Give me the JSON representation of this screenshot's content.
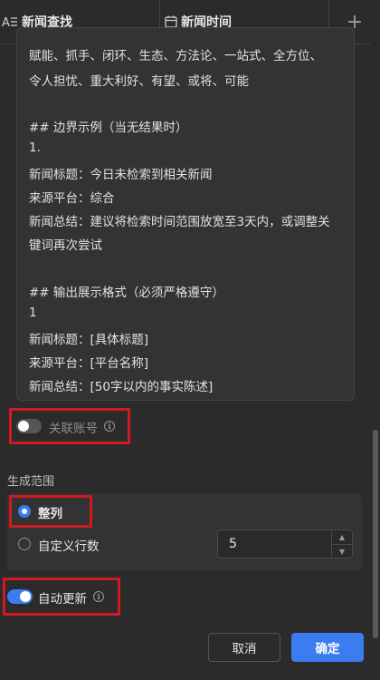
{
  "tabs": [
    {
      "label": "新闻查找",
      "icon": "text-format-icon"
    },
    {
      "label": "新闻时间",
      "icon": "calendar-icon"
    }
  ],
  "add_tab_label": "+",
  "prompt_lines": [
    "赋能、抓手、闭环、生态、方法论、一站式、全方位、",
    "令人担忧、重大利好、有望、或将、可能",
    "",
    "## 边界示例（当无结果时）",
    "1.",
    "新闻标题：今日未检索到相关新闻",
    "来源平台：综合",
    "新闻总结：建议将检索时间范围放宽至3天内，或调整关",
    "键词再次尝试",
    "",
    "## 输出展示格式（必须严格遵守）",
    "1",
    "新闻标题：[具体标题]",
    "来源平台：[平台名称]",
    "新闻总结：[50字以内的事实陈述]"
  ],
  "link_account": {
    "label": "关联账号",
    "enabled": false
  },
  "range": {
    "title": "生成范围",
    "options": [
      {
        "label": "整列",
        "checked": true
      },
      {
        "label": "自定义行数",
        "checked": false
      }
    ],
    "row_count": "5"
  },
  "auto_update": {
    "label": "自动更新",
    "enabled": true
  },
  "buttons": {
    "cancel": "取消",
    "confirm": "确定"
  },
  "colors": {
    "accent": "#3b7cf0",
    "highlight_border": "#d01a22",
    "background": "#2b2b2b"
  }
}
